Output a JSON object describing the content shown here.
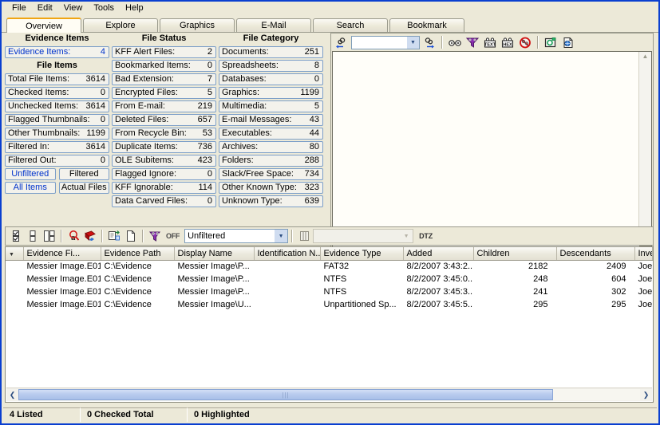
{
  "menubar": {
    "items": [
      "File",
      "Edit",
      "View",
      "Tools",
      "Help"
    ]
  },
  "tabs": [
    {
      "label": "Overview",
      "active": true
    },
    {
      "label": "Explore",
      "active": false
    },
    {
      "label": "Graphics",
      "active": false
    },
    {
      "label": "E-Mail",
      "active": false
    },
    {
      "label": "Search",
      "active": false
    },
    {
      "label": "Bookmark",
      "active": false
    }
  ],
  "evidence_column": {
    "title": "Evidence Items",
    "evidence_items": {
      "label": "Evidence Items:",
      "value": "4"
    },
    "file_items_title": "File Items",
    "rows": [
      {
        "label": "Total File Items:",
        "value": "3614"
      },
      {
        "label": "Checked Items:",
        "value": "0"
      },
      {
        "label": "Unchecked Items:",
        "value": "3614"
      },
      {
        "label": "Flagged Thumbnails:",
        "value": "0"
      },
      {
        "label": "Other Thumbnails:",
        "value": "1199"
      },
      {
        "label": "Filtered In:",
        "value": "3614"
      },
      {
        "label": "Filtered Out:",
        "value": "0"
      }
    ],
    "buttons": [
      {
        "label": "Unfiltered",
        "highlight": true
      },
      {
        "label": "Filtered",
        "highlight": false
      },
      {
        "label": "All Items",
        "highlight": true
      },
      {
        "label": "Actual Files",
        "highlight": false
      }
    ]
  },
  "status_column": {
    "title": "File Status",
    "rows": [
      {
        "label": "KFF Alert Files:",
        "value": "2"
      },
      {
        "label": "Bookmarked Items:",
        "value": "0"
      },
      {
        "label": "Bad Extension:",
        "value": "7"
      },
      {
        "label": "Encrypted Files:",
        "value": "5"
      },
      {
        "label": "From E-mail:",
        "value": "219"
      },
      {
        "label": "Deleted Files:",
        "value": "657"
      },
      {
        "label": "From Recycle Bin:",
        "value": "53"
      },
      {
        "label": "Duplicate Items:",
        "value": "736"
      },
      {
        "label": "OLE Subitems:",
        "value": "423"
      },
      {
        "label": "Flagged Ignore:",
        "value": "0"
      },
      {
        "label": "KFF Ignorable:",
        "value": "114"
      },
      {
        "label": "Data Carved Files:",
        "value": "0"
      }
    ]
  },
  "category_column": {
    "title": "File Category",
    "rows": [
      {
        "label": "Documents:",
        "value": "251"
      },
      {
        "label": "Spreadsheets:",
        "value": "8"
      },
      {
        "label": "Databases:",
        "value": "0"
      },
      {
        "label": "Graphics:",
        "value": "1199"
      },
      {
        "label": "Multimedia:",
        "value": "5"
      },
      {
        "label": "E-mail Messages:",
        "value": "43"
      },
      {
        "label": "Executables:",
        "value": "44"
      },
      {
        "label": "Archives:",
        "value": "80"
      },
      {
        "label": "Folders:",
        "value": "288"
      },
      {
        "label": "Slack/Free Space:",
        "value": "734"
      },
      {
        "label": "Other Known Type:",
        "value": "323"
      },
      {
        "label": "Unknown Type:",
        "value": "639"
      }
    ]
  },
  "viewer_toolbar": {
    "find_prev_icon": "find-previous-icon",
    "search_value": "",
    "search_placeholder": "",
    "find_next_icon": "find-next-icon",
    "icons": [
      "glasses-view-icon",
      "filtered-view-icon",
      "text-view-icon",
      "hex-view-icon",
      "no-view-icon",
      "camera-snapshot-icon",
      "external-viewer-icon"
    ]
  },
  "lower_toolbar": {
    "icons": [
      "check-all-icon",
      "split-panel-icon",
      "tile-panel-icon",
      "find-text-icon",
      "bookmark-icon",
      "copy-items-icon",
      "new-file-icon",
      "filter-icon"
    ],
    "off_label": "OFF",
    "filter_value": "Unfiltered",
    "column_icon": "column-settings-icon",
    "column_value": "",
    "dtz_label": "DTZ"
  },
  "table": {
    "sort_icon": "sort-descending-icon",
    "columns": [
      "Evidence Fi...",
      "Evidence Path",
      "Display Name",
      "Identification N...",
      "Evidence Type",
      "Added",
      "Children",
      "Descendants",
      "Investigator's"
    ],
    "rows": [
      {
        "evidence_file": "Messier Image.E01",
        "evidence_path": "C:\\Evidence",
        "display_name": "Messier Image\\P...",
        "identification": "",
        "evidence_type": "FAT32",
        "added": "8/2/2007 3:43:2...",
        "children": "2182",
        "descendants": "2409",
        "investigator": "Joe Friday"
      },
      {
        "evidence_file": "Messier Image.E01",
        "evidence_path": "C:\\Evidence",
        "display_name": "Messier Image\\P...",
        "identification": "",
        "evidence_type": "NTFS",
        "added": "8/2/2007 3:45:0...",
        "children": "248",
        "descendants": "604",
        "investigator": "Joe Friday"
      },
      {
        "evidence_file": "Messier Image.E01",
        "evidence_path": "C:\\Evidence",
        "display_name": "Messier Image\\P...",
        "identification": "",
        "evidence_type": "NTFS",
        "added": "8/2/2007 3:45:3...",
        "children": "241",
        "descendants": "302",
        "investigator": "Joe Friday"
      },
      {
        "evidence_file": "Messier Image.E01",
        "evidence_path": "C:\\Evidence",
        "display_name": "Messier Image\\U...",
        "identification": "",
        "evidence_type": "Unpartitioned Sp...",
        "added": "8/2/2007 3:45:5...",
        "children": "295",
        "descendants": "295",
        "investigator": "Joe Friday"
      }
    ]
  },
  "statusbar": {
    "listed": "4 Listed",
    "checked": "0 Checked Total",
    "highlighted": "0 Highlighted"
  },
  "colors": {
    "accent_tab": "#f0a513",
    "window_border": "#0a3fd0",
    "panel_bg": "#ece9d8",
    "stat_border": "#7b9ec8",
    "link_text": "#0033cc"
  }
}
